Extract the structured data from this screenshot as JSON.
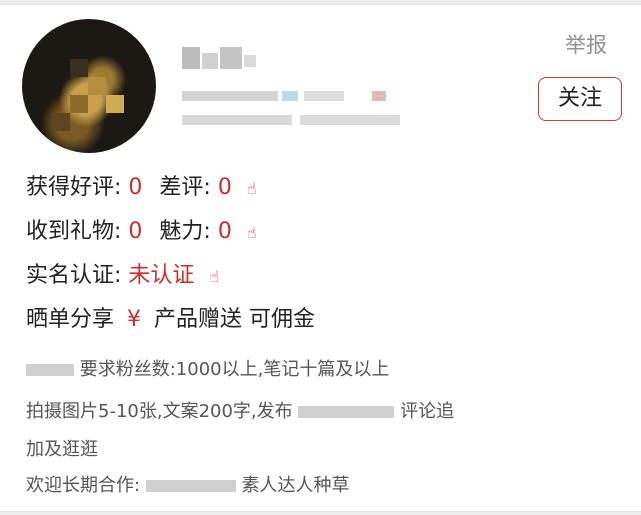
{
  "header": {
    "report_label": "举报",
    "follow_label": "关注"
  },
  "stats": {
    "good_label": "获得好评:",
    "good_value": "0",
    "bad_label": "差评:",
    "bad_value": "0",
    "gift_label": "收到礼物:",
    "gift_value": "0",
    "charm_label": "魅力:",
    "charm_value": "0",
    "verify_label": "实名认证:",
    "verify_value": "未认证",
    "share_label": "晒单分享",
    "yen": "¥",
    "product_label": "产品赠送",
    "commission_label": "可佣金"
  },
  "description": {
    "line1_text": "要求粉丝数:1000以上,笔记十篇及以上",
    "line2_prefix": "拍摄图片5-10张,文案200字,发布",
    "line2_suffix": "评论追",
    "line3_text": "加及逛逛",
    "line4_prefix": "欢迎长期合作:",
    "line4_suffix": "素人达人种草"
  },
  "colors": {
    "accent_red": "#cf2b2b",
    "follow_border": "#cf3b3b",
    "muted_gray": "#8f8f8f"
  },
  "icons": {
    "hand": "pointing-hand-icon"
  }
}
